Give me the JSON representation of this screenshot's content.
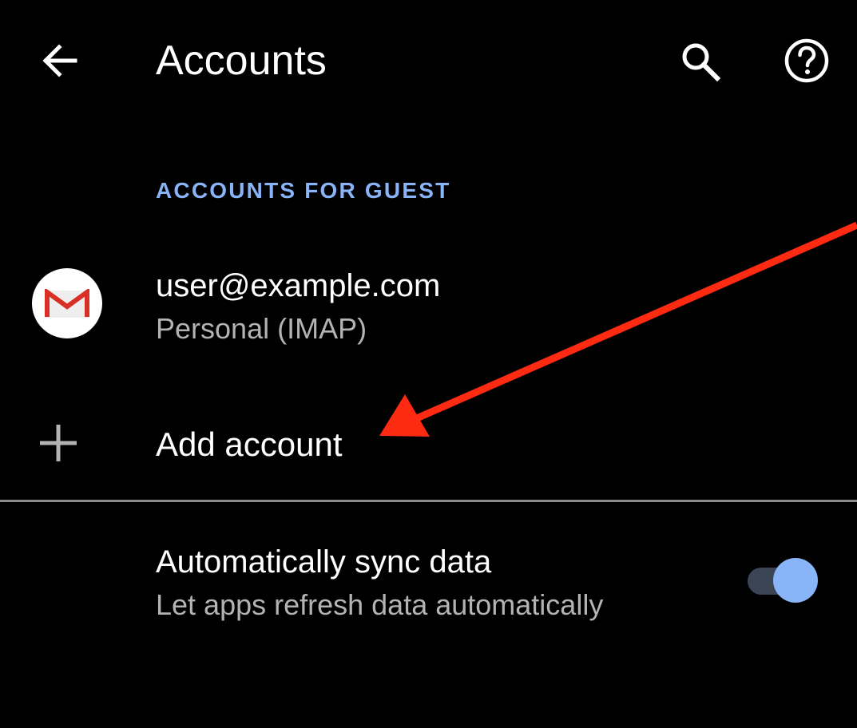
{
  "app_bar": {
    "title": "Accounts",
    "back_icon": "arrow-back-icon",
    "search_icon": "search-icon",
    "help_icon": "help-circle-icon"
  },
  "section": {
    "header": "ACCOUNTS FOR GUEST"
  },
  "accounts": [
    {
      "email": "user@example.com",
      "type": "Personal (IMAP)",
      "icon": "gmail-icon"
    }
  ],
  "add_account": {
    "label": "Add account",
    "icon": "plus-icon"
  },
  "sync": {
    "title": "Automatically sync data",
    "subtitle": "Let apps refresh data automatically",
    "enabled": true
  },
  "colors": {
    "background": "#000000",
    "text_primary": "#ffffff",
    "text_secondary": "#b3b3b3",
    "accent": "#8ab4f8",
    "divider": "#8a8a8a",
    "annotation_arrow": "#ff2a12",
    "gmail_red": "#d93025"
  }
}
